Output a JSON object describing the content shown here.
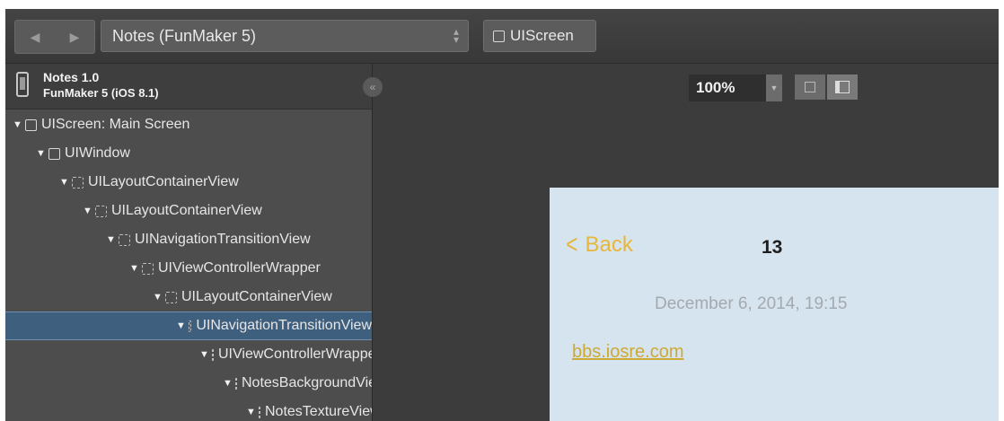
{
  "toolbar": {
    "back_icon": "chevron-left-icon",
    "forward_icon": "chevron-right-icon",
    "scheme": "Notes (FunMaker 5)",
    "breadcrumb": "UIScreen"
  },
  "device": {
    "app_name": "Notes 1.0",
    "device_name": "FunMaker 5 (iOS 8.1)"
  },
  "tree": [
    {
      "label": "UIScreen: Main Screen"
    },
    {
      "label": "UIWindow"
    },
    {
      "label": "UILayoutContainerView"
    },
    {
      "label": "UILayoutContainerView"
    },
    {
      "label": "UINavigationTransitionView"
    },
    {
      "label": "UIViewControllerWrapper"
    },
    {
      "label": "UILayoutContainerView"
    },
    {
      "label": "UINavigationTransitionView"
    },
    {
      "label": "UIViewControllerWrapperView"
    },
    {
      "label": "NotesBackgroundView"
    },
    {
      "label": "NotesTextureView"
    }
  ],
  "canvas": {
    "zoom": "100%",
    "collapse_icon": "double-chevron-left-icon"
  },
  "note": {
    "back_label": "Back",
    "title": "13",
    "date": "December 6, 2014, 19:15",
    "link": "bbs.iosre.com",
    "accent_color": "#e7b73a",
    "background_color": "#d6e4ef"
  }
}
